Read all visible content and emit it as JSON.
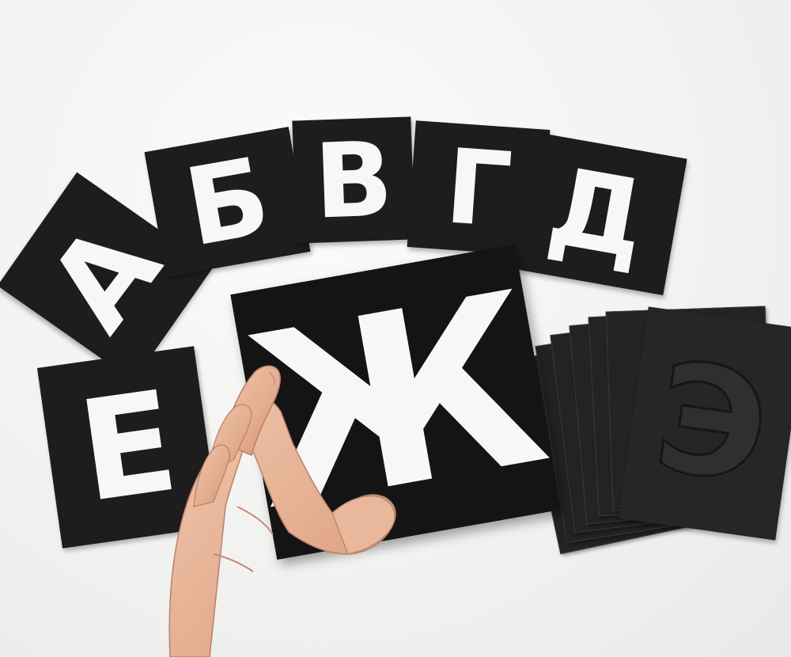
{
  "scene": {
    "background_color": "#f4f4f3",
    "stencil_color": "#1d1d1d",
    "cutout_color": "#f7f7f6",
    "skin_color": "#e7b69a"
  },
  "stencils": {
    "a": "А",
    "be": "Б",
    "ve": "В",
    "ge": "Г",
    "de": "Д",
    "ye": "Е",
    "zhe": "Ж",
    "stack_top": "Э"
  }
}
